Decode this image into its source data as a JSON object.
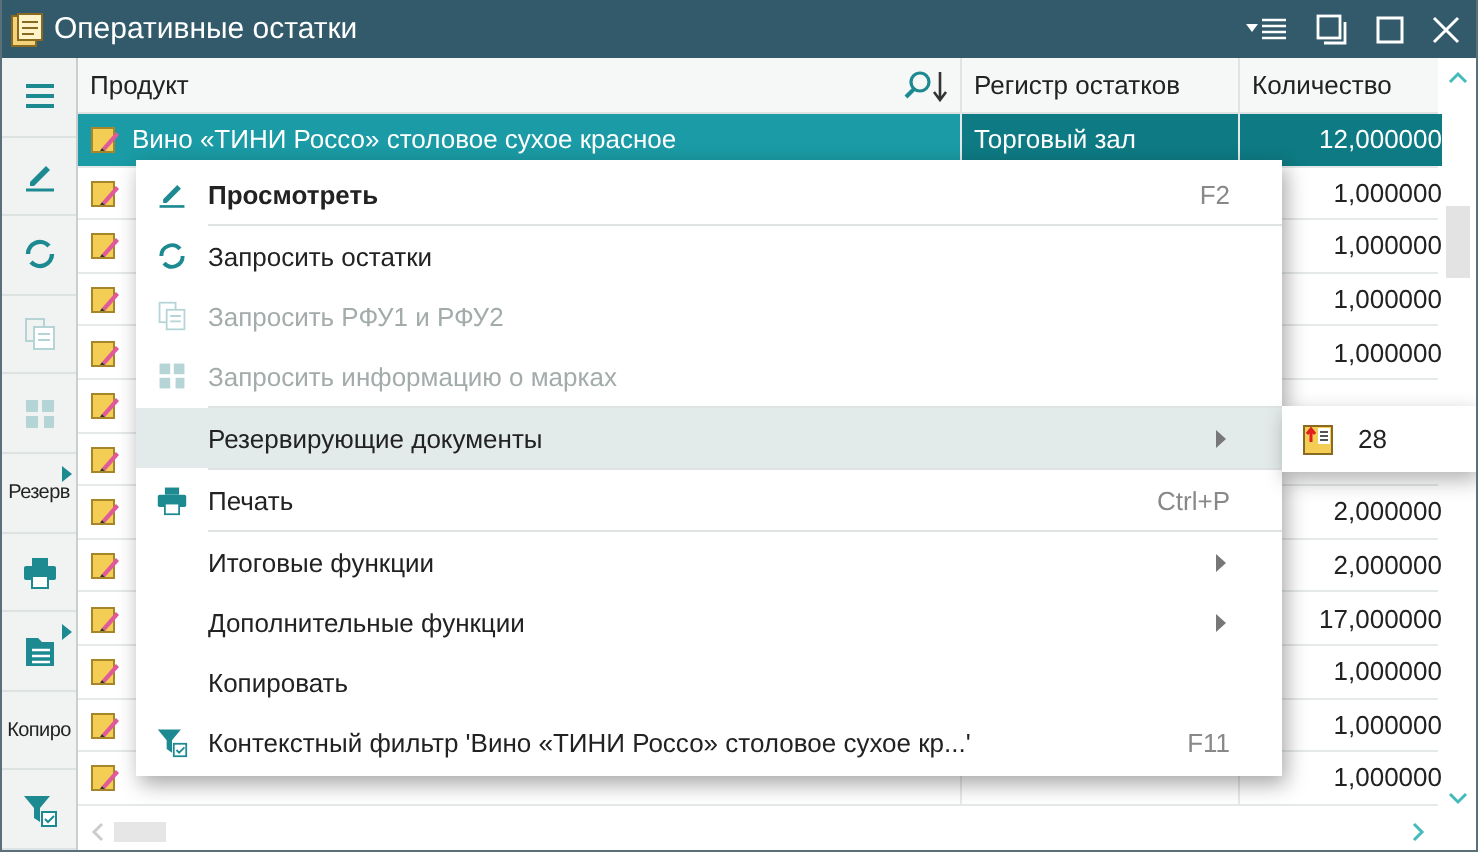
{
  "window": {
    "title": "Оперативные остатки"
  },
  "toolbar": {
    "items": [
      {
        "kind": "icon",
        "disabled": false,
        "submenu": false
      },
      {
        "kind": "icon",
        "disabled": false,
        "submenu": false
      },
      {
        "kind": "icon",
        "disabled": false,
        "submenu": false
      },
      {
        "kind": "icon",
        "disabled": true,
        "submenu": false
      },
      {
        "kind": "icon",
        "disabled": true,
        "submenu": false
      },
      {
        "kind": "label",
        "label": "Резерв",
        "submenu": true
      },
      {
        "kind": "icon",
        "disabled": false,
        "submenu": false
      },
      {
        "kind": "icon",
        "disabled": false,
        "submenu": true
      },
      {
        "kind": "label",
        "label": "Копиро",
        "submenu": false
      },
      {
        "kind": "icon",
        "disabled": false,
        "submenu": false
      }
    ]
  },
  "table": {
    "columns": [
      {
        "label": "Продукт"
      },
      {
        "label": "Регистр остатков"
      },
      {
        "label": "Количество"
      }
    ],
    "rows": [
      {
        "selected": true,
        "product": "Вино «ТИНИ Россо» столовое сухое красное",
        "register": "Торговый зал",
        "quantity": "12,000000"
      },
      {
        "selected": false,
        "quantity": "1,000000"
      },
      {
        "selected": false,
        "quantity": "1,000000"
      },
      {
        "selected": false,
        "quantity": "1,000000"
      },
      {
        "selected": false,
        "quantity": "1,000000"
      },
      {
        "selected": false
      },
      {
        "selected": false
      },
      {
        "selected": false,
        "quantity": "2,000000"
      },
      {
        "selected": false,
        "quantity": "2,000000"
      },
      {
        "selected": false,
        "quantity": "17,000000"
      },
      {
        "selected": false,
        "quantity": "1,000000"
      },
      {
        "selected": false,
        "quantity": "1,000000"
      },
      {
        "selected": false,
        "quantity": "1,000000"
      }
    ]
  },
  "context_menu": {
    "items": [
      {
        "kind": "item",
        "label": "Просмотреть",
        "shortcut": "F2",
        "bold": true,
        "disabled": false,
        "submenu": false,
        "selected": false
      },
      {
        "kind": "separator"
      },
      {
        "kind": "item",
        "label": "Запросить остатки",
        "bold": false,
        "disabled": false,
        "submenu": false,
        "selected": false
      },
      {
        "kind": "item",
        "label": "Запросить РФУ1 и РФУ2",
        "bold": false,
        "disabled": true,
        "submenu": false,
        "selected": false
      },
      {
        "kind": "item",
        "label": "Запросить информацию о марках",
        "bold": false,
        "disabled": true,
        "submenu": false,
        "selected": false
      },
      {
        "kind": "separator"
      },
      {
        "kind": "item",
        "label": "Резервирующие документы",
        "bold": false,
        "disabled": false,
        "submenu": true,
        "selected": true
      },
      {
        "kind": "separator"
      },
      {
        "kind": "item",
        "label": "Печать",
        "shortcut": "Ctrl+P",
        "bold": false,
        "disabled": false,
        "submenu": false,
        "selected": false
      },
      {
        "kind": "separator"
      },
      {
        "kind": "item",
        "label": "Итоговые функции",
        "bold": false,
        "disabled": false,
        "submenu": true,
        "selected": false
      },
      {
        "kind": "item",
        "label": "Дополнительные функции",
        "bold": false,
        "disabled": false,
        "submenu": true,
        "selected": false
      },
      {
        "kind": "item",
        "label": "Копировать",
        "bold": false,
        "disabled": false,
        "submenu": false,
        "selected": false
      },
      {
        "kind": "item",
        "label": "Контекстный фильтр 'Вино «ТИНИ Россо» столовое сухое кр...'",
        "shortcut": "F11",
        "bold": false,
        "disabled": false,
        "submenu": false,
        "selected": false
      }
    ]
  },
  "submenu": {
    "items": [
      {
        "label": "28"
      }
    ]
  }
}
